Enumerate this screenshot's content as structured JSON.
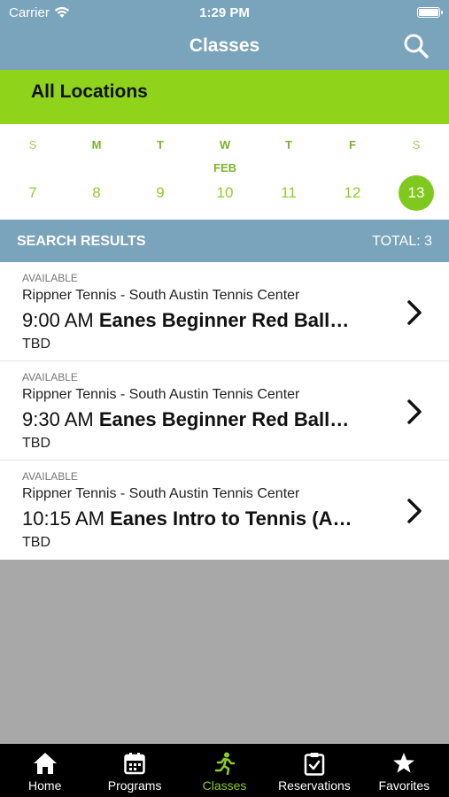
{
  "status_bar": {
    "carrier": "Carrier",
    "time": "1:29 PM"
  },
  "header": {
    "title": "Classes",
    "search_icon": "search-icon"
  },
  "location": {
    "label": "All Locations"
  },
  "calendar": {
    "month": "FEB",
    "days": [
      {
        "dow": "S",
        "date": "7"
      },
      {
        "dow": "M",
        "date": "8"
      },
      {
        "dow": "T",
        "date": "9"
      },
      {
        "dow": "W",
        "date": "10"
      },
      {
        "dow": "T",
        "date": "11"
      },
      {
        "dow": "F",
        "date": "12"
      },
      {
        "dow": "S",
        "date": "13",
        "selected": true
      }
    ]
  },
  "results": {
    "title": "SEARCH RESULTS",
    "total": "TOTAL: 3",
    "items": [
      {
        "status": "AVAILABLE",
        "venue": "Rippner Tennis - South Austin Tennis Center",
        "time": "9:00 AM",
        "name": "Eanes Beginner Red Ball…",
        "instructor": "TBD"
      },
      {
        "status": "AVAILABLE",
        "venue": "Rippner Tennis - South Austin Tennis Center",
        "time": "9:30 AM",
        "name": "Eanes Beginner Red Ball…",
        "instructor": "TBD"
      },
      {
        "status": "AVAILABLE",
        "venue": "Rippner Tennis - South Austin Tennis Center",
        "time": "10:15 AM",
        "name": "Eanes Intro to Tennis (A…",
        "instructor": "TBD"
      }
    ]
  },
  "tabbar": {
    "tabs": [
      {
        "label": "Home",
        "icon": "home-icon"
      },
      {
        "label": "Programs",
        "icon": "calendar-icon"
      },
      {
        "label": "Classes",
        "icon": "runner-icon",
        "active": true
      },
      {
        "label": "Reservations",
        "icon": "clipboard-check-icon"
      },
      {
        "label": "Favorites",
        "icon": "star-icon"
      }
    ]
  },
  "colors": {
    "header": "#7aa3bc",
    "accent_green": "#8fd31a",
    "tab_active": "#8ccc28",
    "background": "#a8a8a8"
  }
}
